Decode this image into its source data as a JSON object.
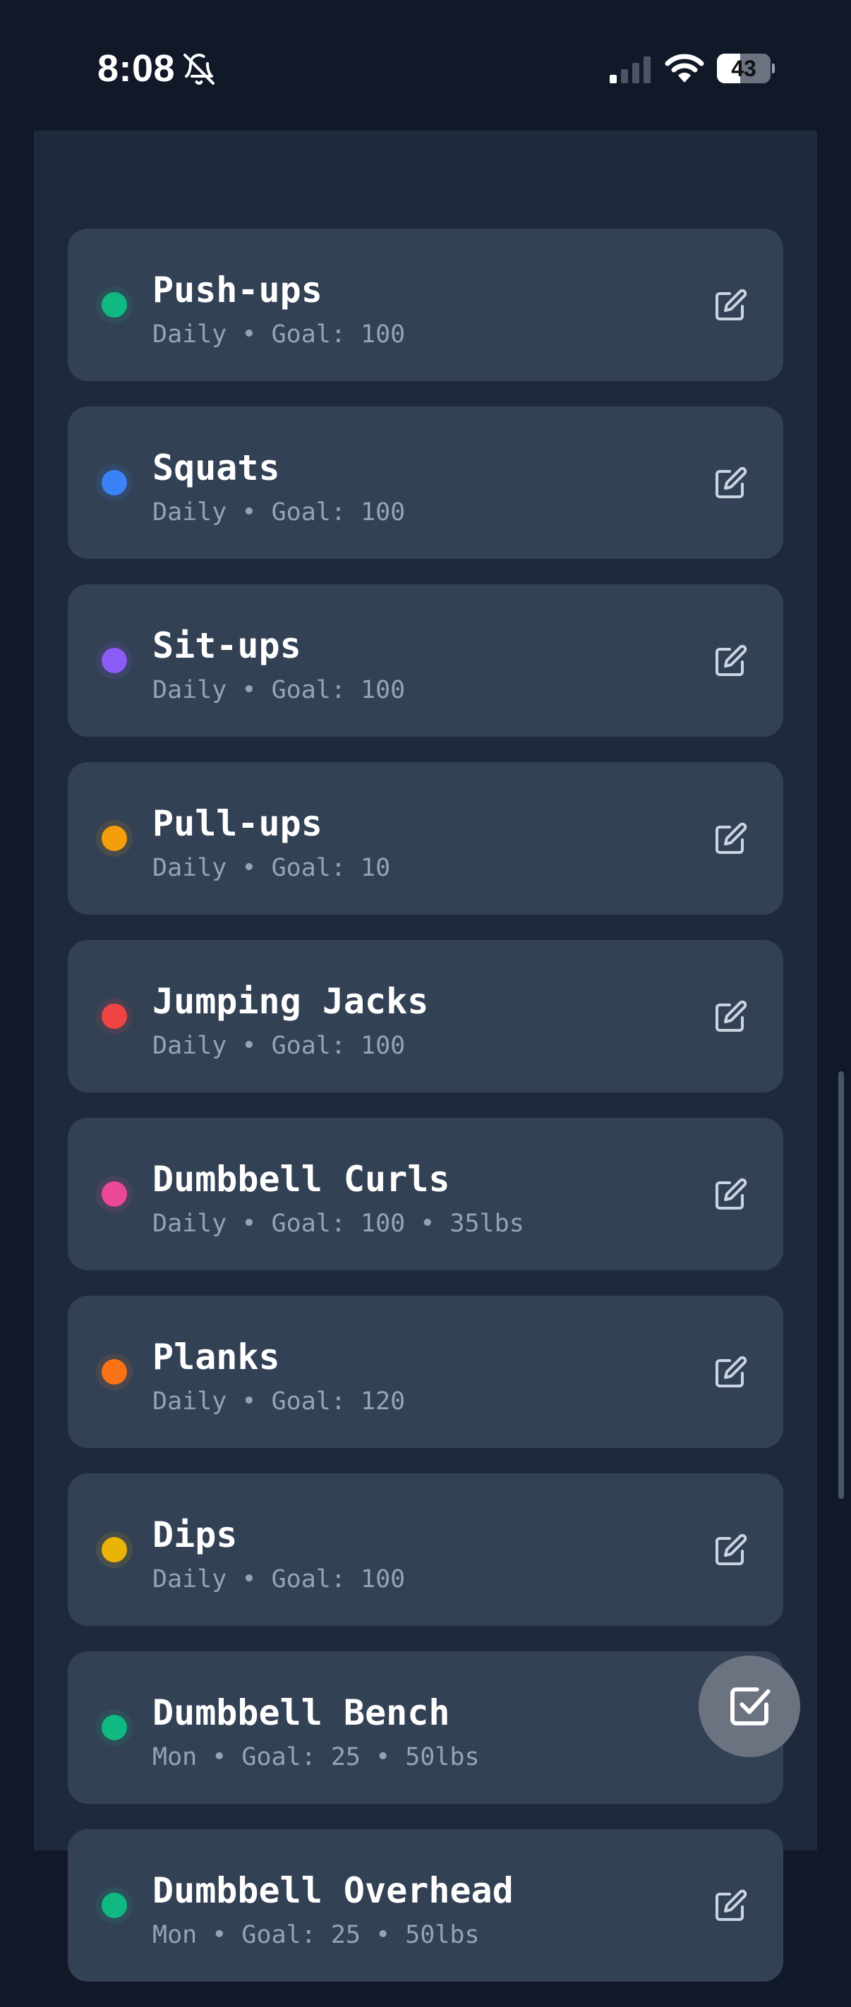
{
  "status_bar": {
    "time": "8:08",
    "battery_level": "43",
    "battery_fraction": 0.43,
    "icons": [
      "bell-slash-icon",
      "cellular-signal-icon",
      "wifi-icon",
      "battery-icon"
    ]
  },
  "colors": {
    "background": "#111827",
    "panel": "#1e293b",
    "card": "#334155",
    "title_text": "#ffffff",
    "meta_text": "#94a3b8",
    "edit_icon": "#cbd5e1",
    "fab": "#6b7280"
  },
  "exercises": [
    {
      "name": "Push-ups",
      "meta": "Daily • Goal: 100",
      "color": "#10b981"
    },
    {
      "name": "Squats",
      "meta": "Daily • Goal: 100",
      "color": "#3b82f6"
    },
    {
      "name": "Sit-ups",
      "meta": "Daily • Goal: 100",
      "color": "#8b5cf6"
    },
    {
      "name": "Pull-ups",
      "meta": "Daily • Goal: 10",
      "color": "#f59e0b"
    },
    {
      "name": "Jumping Jacks",
      "meta": "Daily • Goal: 100",
      "color": "#ef4444"
    },
    {
      "name": "Dumbbell Curls",
      "meta": "Daily • Goal: 100 • 35lbs",
      "color": "#ec4899"
    },
    {
      "name": "Planks",
      "meta": "Daily • Goal: 120",
      "color": "#f97316"
    },
    {
      "name": "Dips",
      "meta": "Daily • Goal: 100",
      "color": "#eab308"
    },
    {
      "name": "Dumbbell Bench",
      "meta": "Mon • Goal: 25 • 50lbs",
      "color": "#10b981"
    },
    {
      "name": "Dumbbell Overhead",
      "meta": "Mon • Goal: 25 • 50lbs",
      "color": "#10b981"
    }
  ],
  "icons": {
    "edit": "edit-icon",
    "fab": "checkbox-check-icon"
  }
}
